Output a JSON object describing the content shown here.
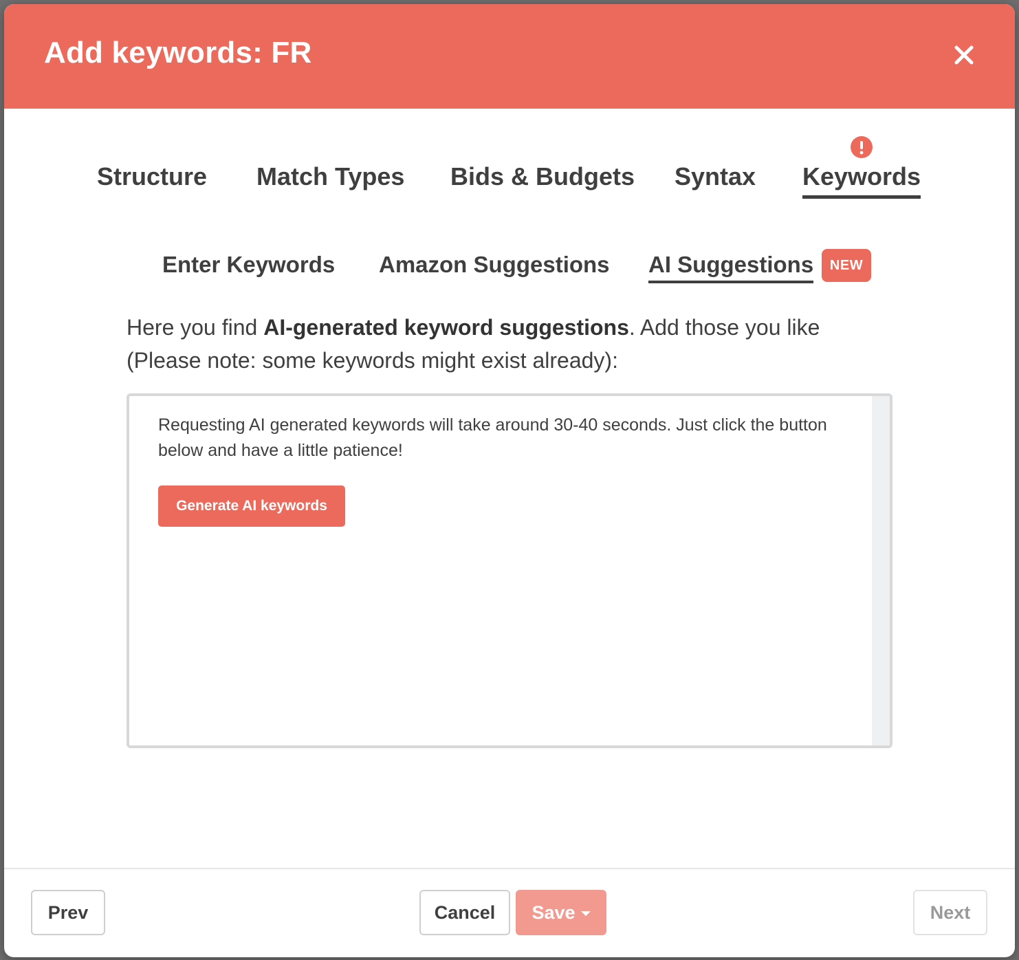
{
  "colors": {
    "accent": "#ec6a5c",
    "accent_disabled": "#f29a90",
    "text": "#3f3f3f"
  },
  "modal": {
    "title": "Add keywords: FR",
    "close_icon": "close-icon"
  },
  "tabs": [
    {
      "label": "Structure",
      "active": false
    },
    {
      "label": "Match Types",
      "active": false
    },
    {
      "label": "Bids & Budgets",
      "active": false
    },
    {
      "label": "Syntax",
      "active": false
    },
    {
      "label": "Keywords",
      "active": true,
      "alert_icon": "exclamation-circle-icon"
    }
  ],
  "subtabs": [
    {
      "label": "Enter Keywords",
      "active": false
    },
    {
      "label": "Amazon Suggestions",
      "active": false
    },
    {
      "label": "AI Suggestions",
      "active": true,
      "badge": "NEW"
    }
  ],
  "intro": {
    "prefix": "Here you find ",
    "bold": "AI-generated keyword suggestions",
    "suffix": ". Add those you like (Please note: some keywords might exist already):"
  },
  "panel": {
    "message": "Requesting AI generated keywords will take around 30-40 seconds. Just click the button below and have a little patience!",
    "generate_label": "Generate AI keywords"
  },
  "footer": {
    "prev_label": "Prev",
    "cancel_label": "Cancel",
    "save_label": "Save",
    "next_label": "Next"
  }
}
